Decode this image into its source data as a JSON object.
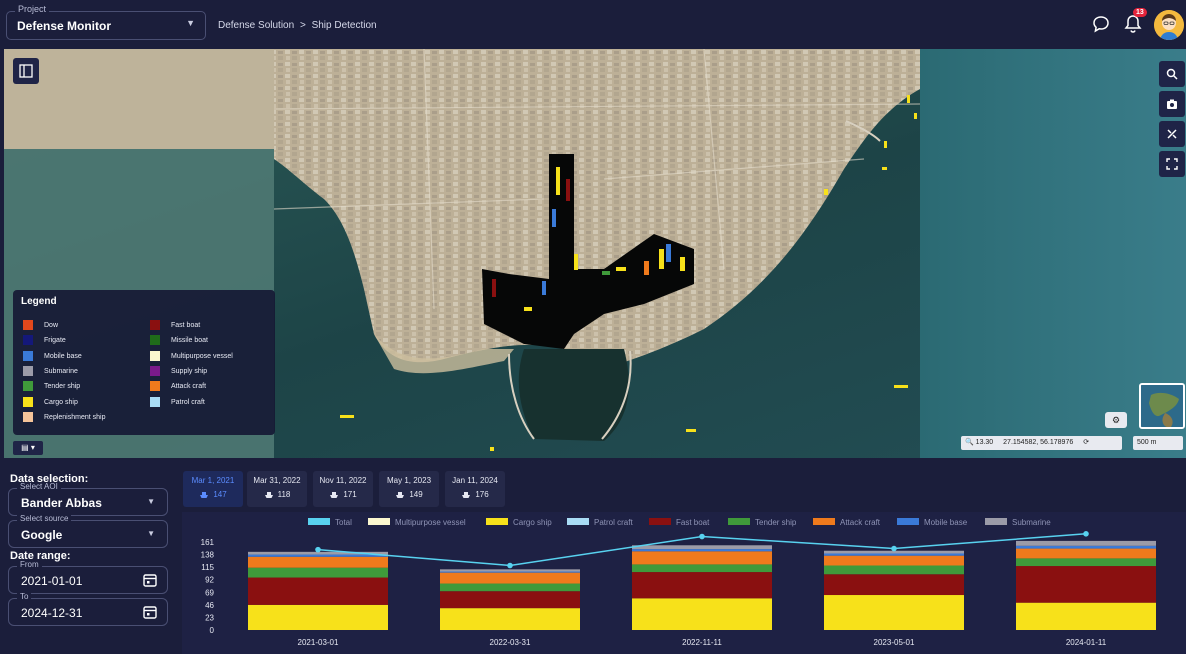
{
  "header": {
    "project_label": "Project",
    "project_value": "Defense Monitor",
    "breadcrumb_root": "Defense Solution",
    "breadcrumb_sep": ">",
    "breadcrumb_current": "Ship Detection",
    "notification_count": "13"
  },
  "map": {
    "legend_title": "Legend",
    "legend_items": [
      {
        "label": "Dow",
        "color": "#e2481c"
      },
      {
        "label": "Frigate",
        "color": "#14187a"
      },
      {
        "label": "Mobile base",
        "color": "#3a7ad8"
      },
      {
        "label": "Submarine",
        "color": "#9b9ba8"
      },
      {
        "label": "Tender ship",
        "color": "#3f9a3a"
      },
      {
        "label": "Cargo ship",
        "color": "#f7e11a"
      },
      {
        "label": "Replenishment ship",
        "color": "#f5c49a"
      },
      {
        "label": "Fast boat",
        "color": "#8a1010"
      },
      {
        "label": "Missile boat",
        "color": "#1f6b1a"
      },
      {
        "label": "Multipurpose vessel",
        "color": "#fbf7cf"
      },
      {
        "label": "Supply ship",
        "color": "#7a1a8a"
      },
      {
        "label": "Attack craft",
        "color": "#ef7a1c"
      },
      {
        "label": "Patrol craft",
        "color": "#a9dcf5"
      }
    ],
    "zoom": "13.30",
    "coordinates": "27.154582, 56.178976",
    "scale": "500 m",
    "tools": [
      "search-icon",
      "camera-icon",
      "measure-icon",
      "fullscreen-icon"
    ]
  },
  "sidebar": {
    "data_selection_title": "Data selection:",
    "aoi_label": "Select AOI",
    "aoi_value": "Bander Abbas",
    "source_label": "Select source",
    "source_value": "Google",
    "date_range_title": "Date range:",
    "from_label": "From",
    "from_value": "2021-01-01",
    "to_label": "To",
    "to_value": "2024-12-31"
  },
  "tabs": [
    {
      "date": "Mar 1, 2021",
      "count": "147",
      "active": true
    },
    {
      "date": "Mar 31, 2022",
      "count": "118",
      "active": false
    },
    {
      "date": "Nov 11, 2022",
      "count": "171",
      "active": false
    },
    {
      "date": "May 1, 2023",
      "count": "149",
      "active": false
    },
    {
      "date": "Jan 11, 2024",
      "count": "176",
      "active": false
    }
  ],
  "chart_data": {
    "type": "bar",
    "stacked": true,
    "categories": [
      "2021-03-01",
      "2022-03-31",
      "2022-11-11",
      "2023-05-01",
      "2024-01-11"
    ],
    "ylim": [
      0,
      161
    ],
    "yticks": [
      0,
      23,
      46,
      69,
      92,
      115,
      138,
      161
    ],
    "grid": false,
    "legend_position": "top",
    "series": [
      {
        "name": "Cargo ship",
        "color": "#f7e11a",
        "values": [
          46,
          40,
          58,
          64,
          50
        ]
      },
      {
        "name": "Fast boat",
        "color": "#8a1010",
        "values": [
          50,
          31,
          48,
          38,
          67
        ]
      },
      {
        "name": "Tender ship",
        "color": "#3f9a3a",
        "values": [
          18,
          14,
          14,
          16,
          14
        ]
      },
      {
        "name": "Attack craft",
        "color": "#ef7a1c",
        "values": [
          20,
          20,
          24,
          18,
          18
        ]
      },
      {
        "name": "Mobile base",
        "color": "#3a7ad8",
        "values": [
          4,
          2,
          4,
          4,
          5
        ]
      },
      {
        "name": "Submarine",
        "color": "#9b9ba8",
        "values": [
          5,
          4,
          7,
          5,
          9
        ]
      },
      {
        "name": "Multipurpose vessel",
        "color": "#fbf7cf",
        "values": [
          0,
          0,
          0,
          0,
          0
        ]
      },
      {
        "name": "Patrol craft",
        "color": "#a9dcf5",
        "values": [
          0,
          0,
          0,
          0,
          0
        ]
      }
    ],
    "line_series": {
      "name": "Total",
      "color": "#58d2f0",
      "values": [
        147,
        118,
        171,
        149,
        176
      ]
    },
    "legend_order": [
      "Total",
      "Multipurpose vessel",
      "Cargo ship",
      "Patrol craft",
      "Fast boat",
      "Tender ship",
      "Attack craft",
      "Mobile base",
      "Submarine"
    ]
  }
}
